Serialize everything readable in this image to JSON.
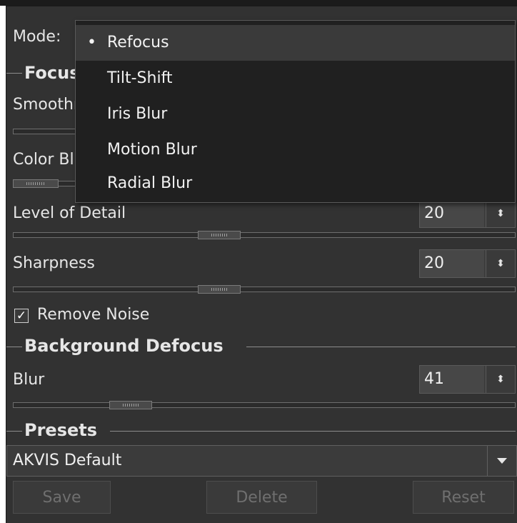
{
  "mode": {
    "label": "Mode:",
    "options": [
      "Refocus",
      "Tilt-Shift",
      "Iris Blur",
      "Motion Blur",
      "Radial Blur"
    ],
    "selected": "Refocus"
  },
  "focus_section": {
    "title": "Focus",
    "smoothness_label": "Smoothness",
    "color_label": "Color Blur",
    "level_of_detail": {
      "label": "Level of Detail",
      "value": "20",
      "fraction": 0.375
    },
    "sharpness": {
      "label": "Sharpness",
      "value": "20",
      "fraction": 0.375
    },
    "remove_noise": {
      "label": "Remove Noise",
      "checked": true,
      "check_glyph": "✓"
    }
  },
  "background_defocus": {
    "title": "Background Defocus",
    "blur": {
      "label": "Blur",
      "value": "41",
      "fraction": 0.2
    }
  },
  "presets": {
    "title": "Presets",
    "selected": "AKVIS Default",
    "buttons": {
      "save": "Save",
      "delete": "Delete",
      "reset": "Reset"
    }
  },
  "glyphs": {
    "bullet": "•",
    "spin": "⬍"
  }
}
